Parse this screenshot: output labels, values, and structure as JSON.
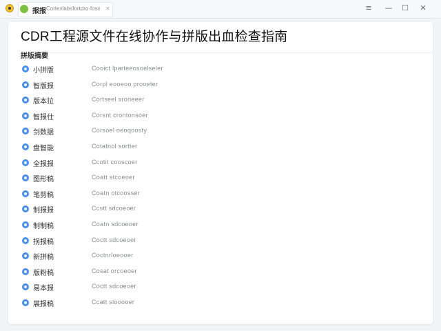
{
  "window": {
    "tab_name": "报报",
    "tab_url": "Cortexlabsfortdro-fosas",
    "tab_close": "×",
    "controls": {
      "menu": "≡",
      "minimize": "—",
      "maximize": "☐",
      "close": "✕"
    }
  },
  "page": {
    "title": "CDR工程源文件在线协作与拼版出血检查指南",
    "section_label": "拼版摘要"
  },
  "items": [
    {
      "name": "小拼版",
      "desc": "Cooict lparteeosoelseler"
    },
    {
      "name": "智版报",
      "desc": "Corpl eooeoo prooeter"
    },
    {
      "name": "版本拉",
      "desc": "Cortseel sroneeer"
    },
    {
      "name": "智报仕",
      "desc": "Corsnt crontonsoer"
    },
    {
      "name": "剑数据",
      "desc": "Corsoel oeoqoosty"
    },
    {
      "name": "盘智能",
      "desc": "Cotatnol sortter"
    },
    {
      "name": "全报报",
      "desc": "Ccotit cooscoer"
    },
    {
      "name": "图形稿",
      "desc": "Coatt stcoeoer"
    },
    {
      "name": "笔剪稿",
      "desc": "Coatn otcoosser"
    },
    {
      "name": "制报报",
      "desc": "Ccstt sdcoeoer"
    },
    {
      "name": "制制稿",
      "desc": "Coatn sdcoeoer"
    },
    {
      "name": "拐报稿",
      "desc": "Coctt sdcoeoer"
    },
    {
      "name": "新拼稿",
      "desc": "Coctnrloeooer"
    },
    {
      "name": "版粉稿",
      "desc": "Cosat orcoeoer"
    },
    {
      "name": "易本报",
      "desc": "Coctt sdcoeoer"
    },
    {
      "name": "展报稿",
      "desc": "Ccatt slooooer"
    }
  ],
  "colors": {
    "bullet": "#4a8ee6",
    "app_icon": "#f2c230",
    "tab_icon": "#7bc043"
  }
}
